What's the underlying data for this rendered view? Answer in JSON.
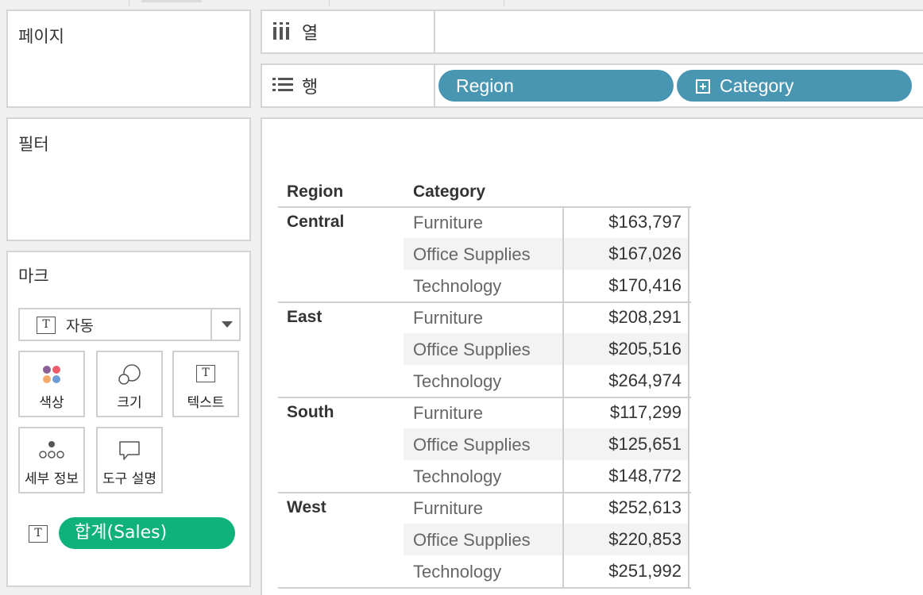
{
  "cards": {
    "pages": "페이지",
    "filters": "필터",
    "marks": "마크"
  },
  "shelves": {
    "columns_label": "열",
    "rows_label": "행",
    "rows_pills": [
      "Region",
      "Category"
    ]
  },
  "marks": {
    "type_value": "자동",
    "buttons": {
      "color": "색상",
      "size": "크기",
      "text": "텍스트",
      "detail": "세부 정보",
      "tooltip": "도구 설명"
    },
    "field_pill": "합계(Sales)",
    "colors": {
      "dimension_pill": "#4996b2",
      "measure_pill": "#10b27b",
      "color_dots": [
        "#8a5f94",
        "#ef5b6b",
        "#f4a96a",
        "#6f9cd4"
      ]
    }
  },
  "view": {
    "col_headers": [
      "Region",
      "Category"
    ],
    "groups": [
      {
        "region": "Central",
        "rows": [
          {
            "category": "Furniture",
            "value": "$163,797"
          },
          {
            "category": "Office Supplies",
            "value": "$167,026"
          },
          {
            "category": "Technology",
            "value": "$170,416"
          }
        ]
      },
      {
        "region": "East",
        "rows": [
          {
            "category": "Furniture",
            "value": "$208,291"
          },
          {
            "category": "Office Supplies",
            "value": "$205,516"
          },
          {
            "category": "Technology",
            "value": "$264,974"
          }
        ]
      },
      {
        "region": "South",
        "rows": [
          {
            "category": "Furniture",
            "value": "$117,299"
          },
          {
            "category": "Office Supplies",
            "value": "$125,651"
          },
          {
            "category": "Technology",
            "value": "$148,772"
          }
        ]
      },
      {
        "region": "West",
        "rows": [
          {
            "category": "Furniture",
            "value": "$252,613"
          },
          {
            "category": "Office Supplies",
            "value": "$220,853"
          },
          {
            "category": "Technology",
            "value": "$251,992"
          }
        ]
      }
    ]
  }
}
